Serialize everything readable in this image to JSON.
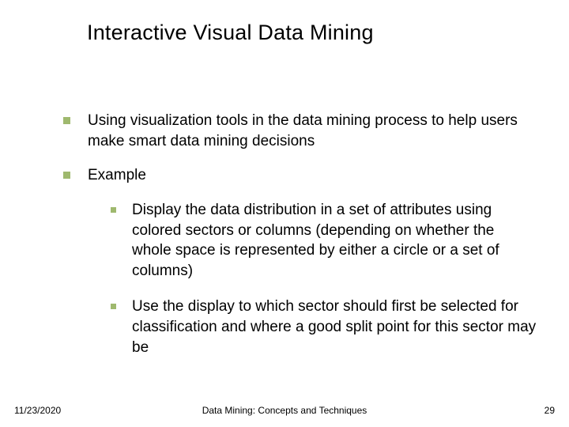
{
  "title": "Interactive Visual Data Mining",
  "bullets": {
    "b1": "Using visualization tools in the data mining process to help users make smart data mining decisions",
    "b2": "Example",
    "b2_1": "Display the data distribution in a set of attributes using colored sectors or columns (depending on whether the whole space is represented by either a circle or a set of columns)",
    "b2_2": "Use the display to which sector should first be selected for classification and where a good split point for this sector may be"
  },
  "footer": {
    "date": "11/23/2020",
    "center": "Data Mining: Concepts and Techniques",
    "page": "29"
  }
}
